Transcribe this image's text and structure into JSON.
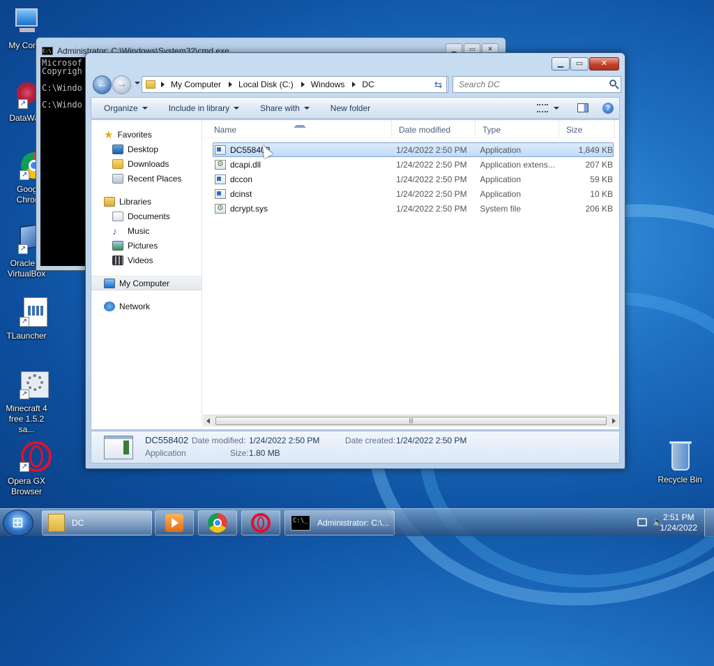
{
  "desktop": {
    "icons": [
      {
        "label": "My Comp",
        "icon": "computer-icon"
      },
      {
        "label": "DataWag",
        "icon": "datawag-icon"
      },
      {
        "label": "Googl\nChron",
        "icon": "chrome-icon"
      },
      {
        "label": "Oracle V\nVirtualBox",
        "icon": "virtualbox-icon"
      },
      {
        "label": "TLauncher",
        "icon": "tlauncher-icon"
      },
      {
        "label": "Minecraft 4\nfree 1.5.2 sa...",
        "icon": "minecraft-icon"
      },
      {
        "label": "Opera GX\nBrowser",
        "icon": "opera-icon"
      },
      {
        "label": "Recycle Bin",
        "icon": "recycle-bin-icon"
      }
    ]
  },
  "cmd": {
    "title": "Administrator: C:\\Windows\\System32\\cmd.exe",
    "console_text": "Microsof\nCopyrigh\n\nC:\\Windo\n\nC:\\Windo"
  },
  "explorer": {
    "breadcrumb": [
      "My Computer",
      "Local Disk (C:)",
      "Windows",
      "DC"
    ],
    "search_placeholder": "Search DC",
    "toolbar": {
      "organize": "Organize",
      "include": "Include in library",
      "share": "Share with",
      "new_folder": "New folder"
    },
    "nav": {
      "favorites": "Favorites",
      "desktop": "Desktop",
      "downloads": "Downloads",
      "recent": "Recent Places",
      "libraries": "Libraries",
      "documents": "Documents",
      "music": "Music",
      "pictures": "Pictures",
      "videos": "Videos",
      "computer": "My Computer",
      "network": "Network"
    },
    "columns": {
      "name": "Name",
      "date": "Date modified",
      "type": "Type",
      "size": "Size"
    },
    "files": [
      {
        "name": "DC558402",
        "date": "1/24/2022 2:50 PM",
        "type": "Application",
        "size": "1,849 KB"
      },
      {
        "name": "dcapi.dll",
        "date": "1/24/2022 2:50 PM",
        "type": "Application extens...",
        "size": "207 KB"
      },
      {
        "name": "dccon",
        "date": "1/24/2022 2:50 PM",
        "type": "Application",
        "size": "59 KB"
      },
      {
        "name": "dcinst",
        "date": "1/24/2022 2:50 PM",
        "type": "Application",
        "size": "10 KB"
      },
      {
        "name": "dcrypt.sys",
        "date": "1/24/2022 2:50 PM",
        "type": "System file",
        "size": "206 KB"
      }
    ],
    "details": {
      "name": "DC558402",
      "type": "Application",
      "date_modified_label": "Date modified:",
      "date_modified": "1/24/2022 2:50 PM",
      "size_label": "Size:",
      "size": "1.80 MB",
      "date_created_label": "Date created:",
      "date_created": "1/24/2022 2:50 PM"
    }
  },
  "taskbar": {
    "explorer_label": "DC",
    "cmd_label": "Administrator: C:\\...",
    "time": "2:51 PM",
    "date": "1/24/2022"
  }
}
